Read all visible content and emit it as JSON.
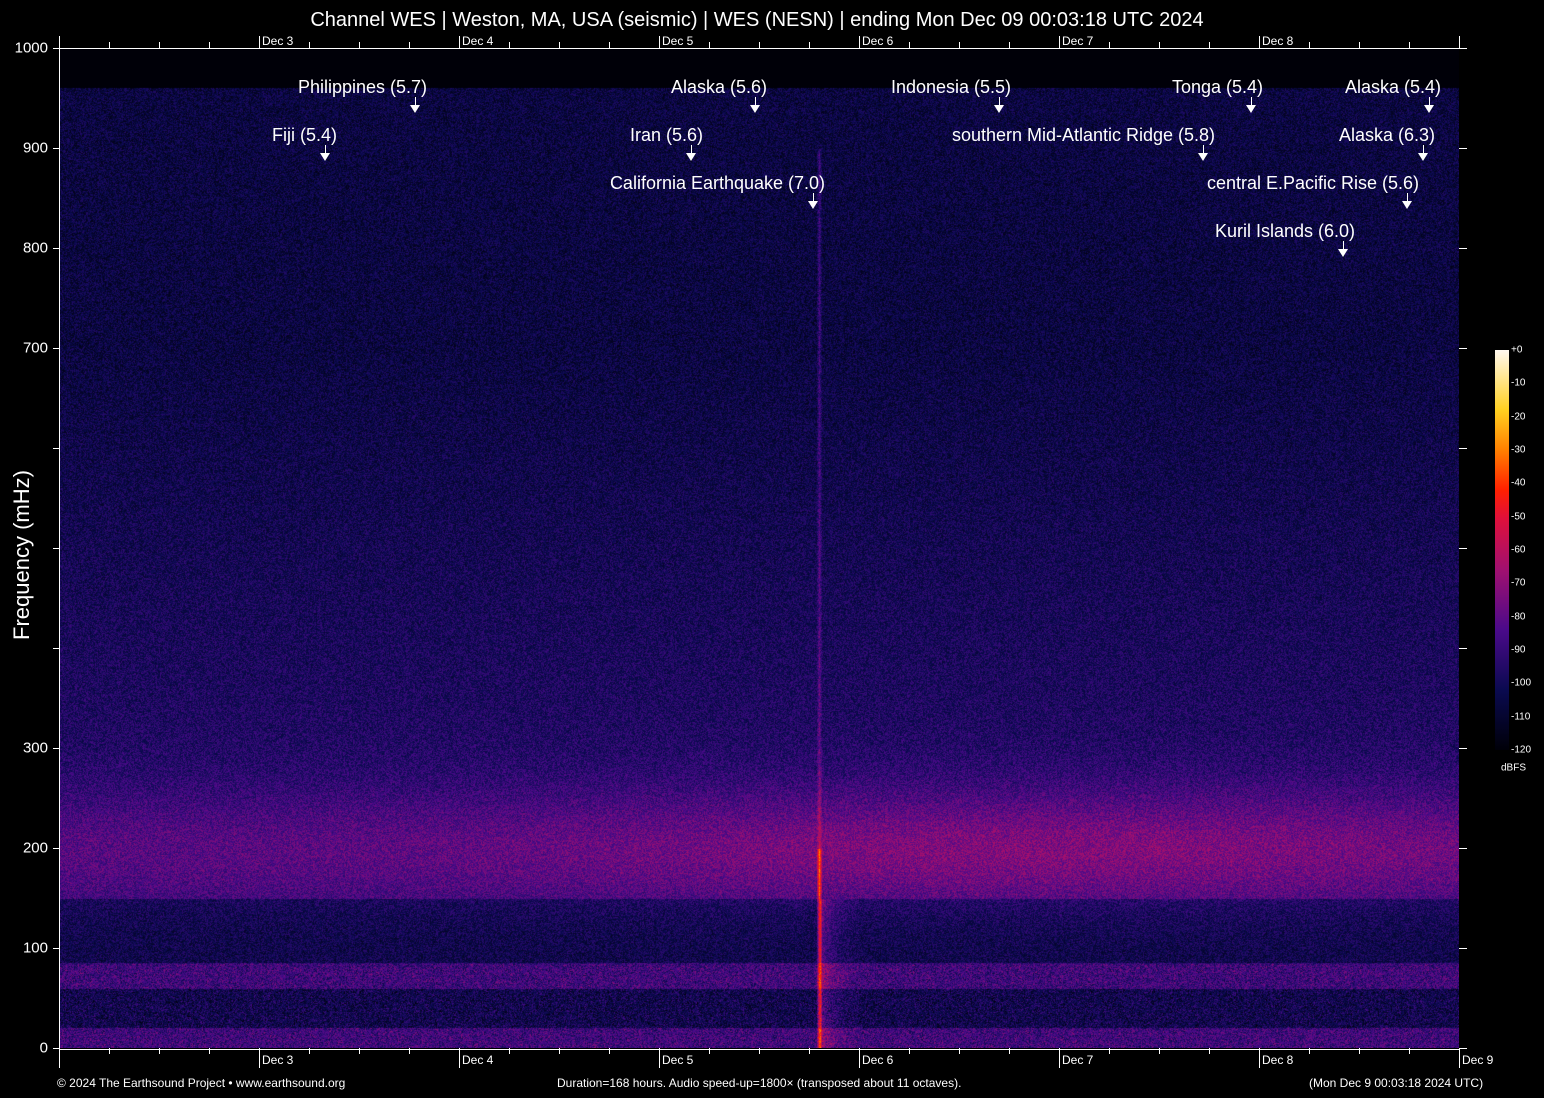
{
  "title": "Channel WES | Weston, MA, USA (seismic) | WES (NESN) | ending Mon Dec 09 00:03:18 UTC 2024",
  "chart_data": {
    "type": "heatmap",
    "title": "Channel WES | Weston, MA, USA (seismic) | WES (NESN) | ending Mon Dec 09 00:03:18 UTC 2024",
    "ylabel": "Frequency (mHz)",
    "ylim": [
      0,
      1000
    ],
    "yticks": [
      0,
      100,
      200,
      300,
      400,
      500,
      600,
      700,
      800,
      900,
      1000
    ],
    "ytick_labels": [
      "0",
      "100",
      "200",
      "300",
      "",
      "",
      "",
      "700",
      "800",
      "900",
      "1000"
    ],
    "x_days_range": [
      0,
      7
    ],
    "xtick_labels_top": [
      "Dec  3",
      "Dec  4",
      "Dec  5",
      "Dec  6",
      "Dec  7",
      "Dec  8"
    ],
    "xtick_labels_bottom": [
      "Dec  3",
      "Dec  4",
      "Dec  5",
      "Dec  6",
      "Dec  7",
      "Dec  8",
      "Dec  9"
    ],
    "colorbar": {
      "label": "dBFS",
      "range": [
        -120,
        0
      ],
      "ticks": [
        "+0",
        "-10",
        "-20",
        "-30",
        "-40",
        "-50",
        "-60",
        "-70",
        "-80",
        "-90",
        "-100",
        "-110",
        "-120"
      ]
    },
    "events": [
      {
        "label": "Philippines (5.7)",
        "day": 1.78,
        "row": 0
      },
      {
        "label": "Alaska (5.6)",
        "day": 3.48,
        "row": 0
      },
      {
        "label": "Indonesia (5.5)",
        "day": 4.7,
        "row": 0
      },
      {
        "label": "Tonga (5.4)",
        "day": 5.96,
        "row": 0
      },
      {
        "label": "Alaska (5.4)",
        "day": 6.85,
        "row": 0
      },
      {
        "label": "Fiji (5.4)",
        "day": 1.33,
        "row": 1
      },
      {
        "label": "Iran (5.6)",
        "day": 3.16,
        "row": 1
      },
      {
        "label": "southern Mid-Atlantic Ridge (5.8)",
        "day": 5.72,
        "row": 1
      },
      {
        "label": "Alaska (6.3)",
        "day": 6.82,
        "row": 1
      },
      {
        "label": "California Earthquake (7.0)",
        "day": 3.77,
        "row": 2
      },
      {
        "label": "central E.Pacific Rise (5.6)",
        "day": 6.74,
        "row": 2
      },
      {
        "label": "Kuril Islands (6.0)",
        "day": 6.42,
        "row": 3
      }
    ]
  },
  "footer": {
    "left": "© 2024 The Earthsound Project • www.earthsound.org",
    "center": "Duration=168 hours. Audio speed-up=1800× (transposed about 11 octaves).",
    "right": "(Mon Dec  9 00:03:18 2024 UTC)"
  }
}
